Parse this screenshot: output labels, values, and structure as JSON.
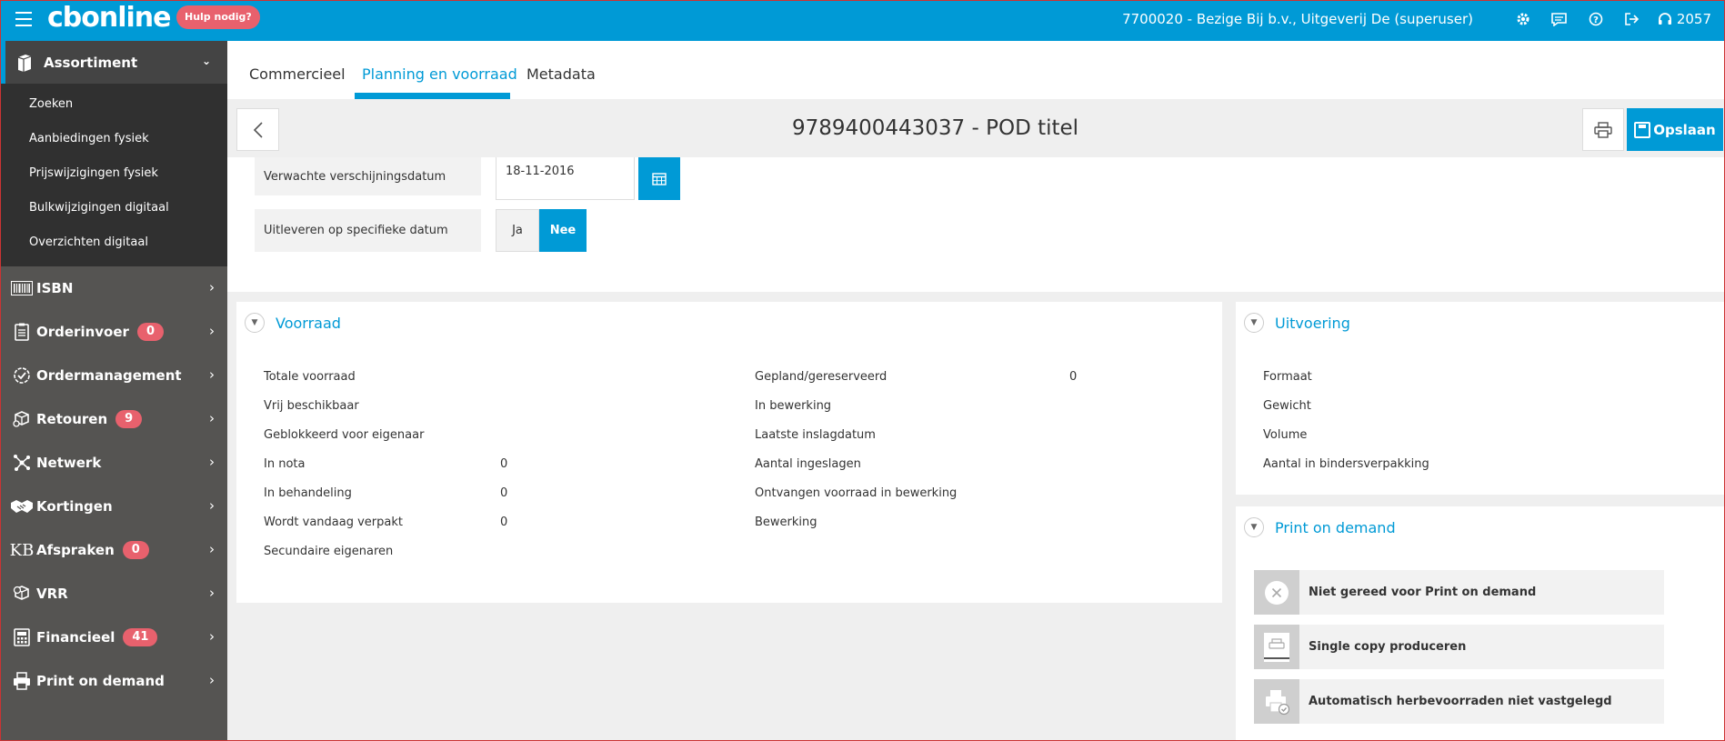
{
  "topbar": {
    "logo": "cbonline",
    "help_label": "Hulp nodig?",
    "account": "7700020 - Bezige Bij b.v., Uitgeverij De (superuser)",
    "icons": [
      "menu-icon",
      "gear-icon",
      "chat-icon",
      "help-icon",
      "logout-icon",
      "headset-icon"
    ],
    "support_number": "2057"
  },
  "sidebar": {
    "assortiment": {
      "label": "Assortiment",
      "sub_items": [
        "Zoeken",
        "Aanbiedingen fysiek",
        "Prijswijzigingen fysiek",
        "Bulkwijzigingen digitaal",
        "Overzichten digitaal"
      ]
    },
    "items": [
      {
        "label": "ISBN",
        "icon": "barcode-icon"
      },
      {
        "label": "Orderinvoer",
        "badge": "0",
        "icon": "clipboard-icon"
      },
      {
        "label": "Ordermanagement",
        "icon": "check-circle-icon"
      },
      {
        "label": "Retouren",
        "badge": "9",
        "icon": "return-box-icon"
      },
      {
        "label": "Netwerk",
        "icon": "network-icon"
      },
      {
        "label": "Kortingen",
        "icon": "handshake-icon"
      },
      {
        "label": "Afspraken",
        "badge": "0",
        "icon": "kb-icon"
      },
      {
        "label": "VRR",
        "icon": "vrr-icon"
      },
      {
        "label": "Financieel",
        "badge": "41",
        "icon": "finance-icon"
      },
      {
        "label": "Print on demand",
        "icon": "printer-icon"
      }
    ]
  },
  "tabs": [
    "Commercieel",
    "Planning en voorraad",
    "Metadata"
  ],
  "title": {
    "text": "9789400443037 - POD titel",
    "save_label": "Opslaan"
  },
  "form": {
    "release_label": "Verwachte verschijningsdatum",
    "release_value": "18-11-2016",
    "deliver_label": "Uitleveren op specifieke datum",
    "yes": "Ja",
    "no": "Nee",
    "selected": "Nee"
  },
  "voorraad": {
    "title": "Voorraad",
    "left": [
      {
        "label": "Totale voorraad",
        "value": ""
      },
      {
        "label": "Vrij beschikbaar",
        "value": ""
      },
      {
        "label": "Geblokkeerd voor eigenaar",
        "value": ""
      },
      {
        "label": "In nota",
        "value": "0"
      },
      {
        "label": "In behandeling",
        "value": "0"
      },
      {
        "label": "Wordt vandaag verpakt",
        "value": "0"
      },
      {
        "label": "Secundaire eigenaren",
        "value": ""
      }
    ],
    "right": [
      {
        "label": "Gepland/gereserveerd",
        "value": "0"
      },
      {
        "label": "In bewerking",
        "value": ""
      },
      {
        "label": "Laatste inslagdatum",
        "value": ""
      },
      {
        "label": "Aantal ingeslagen",
        "value": ""
      },
      {
        "label": "Ontvangen voorraad in bewerking",
        "value": ""
      },
      {
        "label": "Bewerking",
        "value": ""
      }
    ]
  },
  "uitvoering": {
    "title": "Uitvoering",
    "fields": [
      "Formaat",
      "Gewicht",
      "Volume",
      "Aantal in bindersverpakking"
    ]
  },
  "pod": {
    "title": "Print on demand",
    "rows": [
      {
        "label": "Niet gereed voor Print on demand",
        "icon": "cross-circle-icon"
      },
      {
        "label": "Single copy produceren",
        "icon": "print-copy-icon"
      },
      {
        "label": "Automatisch herbevoorraden niet vastgelegd",
        "icon": "printer-check-icon"
      }
    ]
  }
}
